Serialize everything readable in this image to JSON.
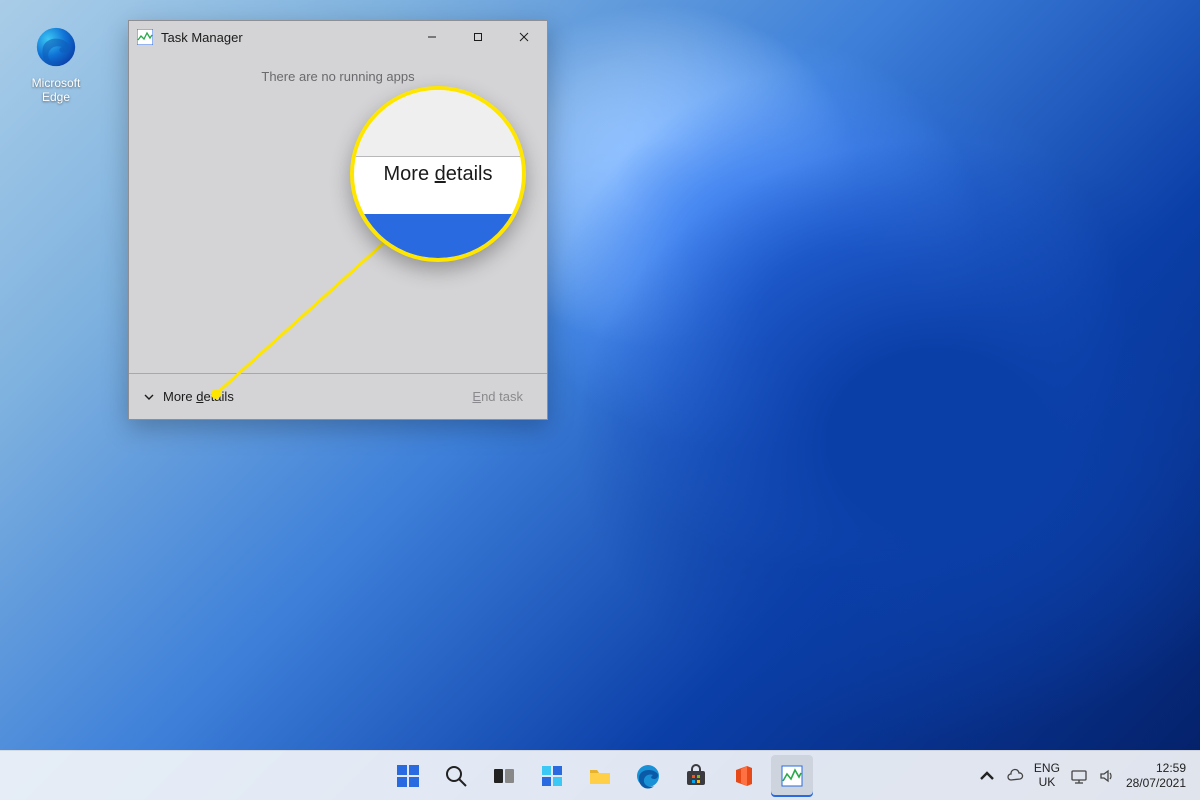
{
  "desktop": {
    "icons": [
      {
        "name": "Microsoft Edge"
      }
    ]
  },
  "task_manager": {
    "title": "Task Manager",
    "status_text": "There are no running apps",
    "more_details_label": "More details",
    "end_task_label": "End task"
  },
  "callout": {
    "text": "More details"
  },
  "taskbar": {
    "items": [
      {
        "id": "start",
        "name": "Start"
      },
      {
        "id": "search",
        "name": "Search"
      },
      {
        "id": "task-view",
        "name": "Task View"
      },
      {
        "id": "widgets",
        "name": "Widgets"
      },
      {
        "id": "file-explorer",
        "name": "File Explorer"
      },
      {
        "id": "edge",
        "name": "Microsoft Edge"
      },
      {
        "id": "store",
        "name": "Microsoft Store"
      },
      {
        "id": "office",
        "name": "Office"
      },
      {
        "id": "task-manager",
        "name": "Task Manager",
        "active": true
      }
    ],
    "system_tray": {
      "overflow": "^",
      "onedrive": "OneDrive",
      "language_primary": "ENG",
      "language_secondary": "UK",
      "network": "Network",
      "volume": "Volume",
      "time": "12:59",
      "date": "28/07/2021"
    }
  }
}
